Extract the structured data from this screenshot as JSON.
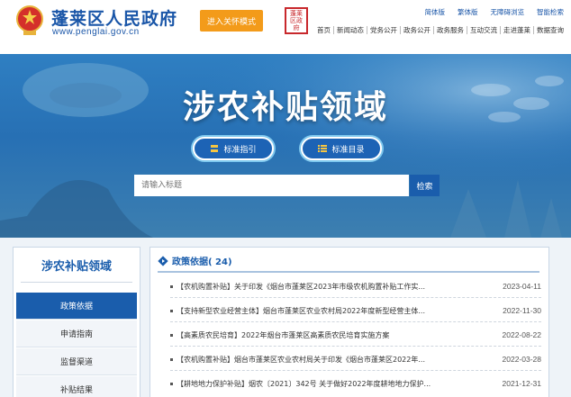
{
  "header": {
    "site_title": "蓬莱区人民政府",
    "site_url": "www.penglai.gov.cn",
    "care_mode_label": "进入关怀模式",
    "seal_text": "蓬莱区\n政府",
    "top_links": [
      "简体版",
      "繁体版",
      "无障碍浏览",
      "智能检索"
    ],
    "nav": [
      "首页",
      "新闻动态",
      "党务公开",
      "政务公开",
      "政务服务",
      "互动交流",
      "走进蓬莱",
      "数据查询"
    ]
  },
  "banner": {
    "title": "涉农补贴领域",
    "pill_guide": "标准指引",
    "pill_catalog": "标准目录",
    "search_placeholder": "请输入标题",
    "search_button": "检索"
  },
  "sidebar": {
    "title": "涉农补贴领域",
    "items": [
      "政策依据",
      "申请指南",
      "监督渠道",
      "补贴结果"
    ]
  },
  "main": {
    "title": "政策依据( 24)",
    "rows": [
      {
        "text": "【农机购置补贴】关于印发《烟台市蓬莱区2023年市级农机购置补贴工作实...",
        "date": "2023-04-11"
      },
      {
        "text": "【支持新型农业经营主体】烟台市蓬莱区农业农村局2022年度新型经营主体...",
        "date": "2022-11-30"
      },
      {
        "text": "【高素质农民培育】2022年烟台市蓬莱区高素质农民培育实施方案",
        "date": "2022-08-22"
      },
      {
        "text": "【农机购置补贴】烟台市蓬莱区农业农村局关于印发《烟台市蓬莱区2022年...",
        "date": "2022-03-28"
      },
      {
        "text": "【耕地地力保护补贴】烟农〔2021〕342号 关于做好2022年度耕地地力保护...",
        "date": "2021-12-31"
      }
    ]
  },
  "colors": {
    "brand_blue": "#1a5dac",
    "care_orange": "#f39b1a",
    "seal_red": "#c8282c"
  },
  "icons": {
    "emblem": "national-emblem-icon",
    "pill_guide": "book-icon",
    "pill_catalog": "list-icon",
    "main_head": "diamond-nav-icon"
  }
}
